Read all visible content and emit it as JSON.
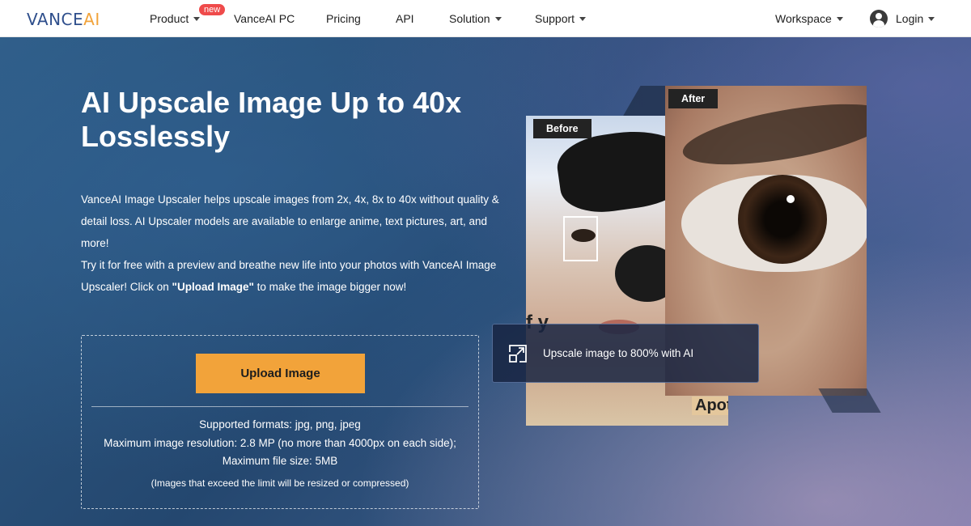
{
  "nav": {
    "logo_main": "VANCE",
    "logo_accent": "AI",
    "items": [
      {
        "label": "Product"
      },
      {
        "label": "VanceAI PC"
      },
      {
        "label": "Pricing"
      },
      {
        "label": "API"
      },
      {
        "label": "Solution"
      },
      {
        "label": "Support"
      }
    ],
    "badge": "new",
    "workspace": "Workspace",
    "login": "Login"
  },
  "hero": {
    "title": "AI Upscale Image Up to 40x Losslessly",
    "desc_line1": "VanceAI Image Upscaler helps upscale images from 2x, 4x, 8x to 40x without quality & detail loss. AI Upscaler models are available to enlarge anime, text pictures, art, and more!",
    "desc_line2_pre": "Try it for free with a preview and breathe new life into your photos with VanceAI Image Upscaler! Click on ",
    "desc_line2_bold": "\"Upload Image\"",
    "desc_line2_post": " to make the image bigger now!"
  },
  "upload": {
    "button_label": "Upload Image",
    "formats": "Supported formats: jpg, png, jpeg",
    "resolution": "Maximum image resolution: 2.8 MP (no more than 4000px on each side);",
    "filesize": "Maximum file size: 5MB",
    "note": "(Images that exceed the limit will be resized or compressed)"
  },
  "compare": {
    "before_label": "Before",
    "after_label": "After",
    "before_text": "f y",
    "after_text": "Apoth",
    "info_text": "Upscale image to 800% with AI"
  },
  "colors": {
    "accent": "#f2a33a",
    "logo_blue": "#2f4f8c",
    "badge_red": "#ef4b4b"
  }
}
